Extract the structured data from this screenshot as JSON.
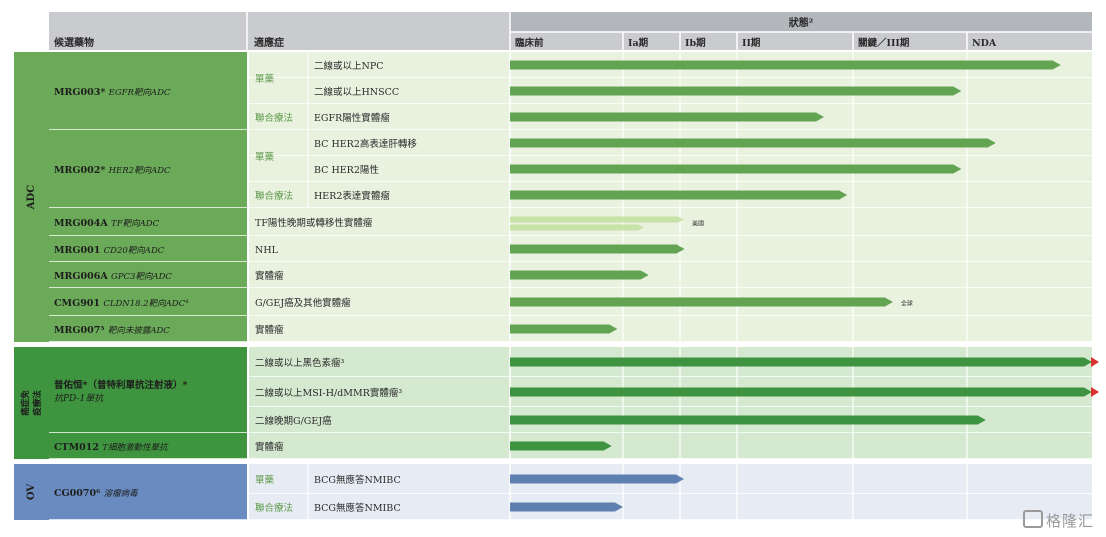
{
  "header": {
    "candidate_label": "候選藥物",
    "indication_label": "適應症",
    "status_label": "狀態²",
    "phases": [
      "臨床前",
      "Ia期",
      "Ib期",
      "II期",
      "關鍵／III期",
      "NDA"
    ]
  },
  "colors": {
    "adc_band": "#6aaa58",
    "adc_row": "#e9f1df",
    "adc_bar": "#62a451",
    "adc_light_bar": "#c7e3a8",
    "io_band": "#3f953f",
    "io_row": "#d5e9d0",
    "io_bar": "#3e9340",
    "ov_band": "#6a8bbf",
    "ov_row": "#e7ecf4",
    "ov_bar": "#5e80b1",
    "header_bg": "#bcbec3",
    "arrow_red": "#d9332f",
    "single_drug_text": "#5d9a4a"
  },
  "groups": [
    {
      "id": "adc",
      "label": "ADC",
      "candidates": [
        {
          "id": "mrg003",
          "name": "MRG003*",
          "target": "EGFR靶向ADC",
          "rows": [
            {
              "type": "單藥",
              "indication": "二線或以上NPC",
              "phase": 5.75
            },
            {
              "type": "",
              "indication": "二線或以上HNSCC",
              "phase": 4.95
            },
            {
              "type": "聯合療法",
              "indication": "EGFR陽性實體瘤",
              "phase": 3.75
            }
          ]
        },
        {
          "id": "mrg002",
          "name": "MRG002*",
          "target": "HER2靶向ADC",
          "rows": [
            {
              "type": "單藥",
              "indication": "BC HER2高表達肝轉移",
              "phase": 5.23
            },
            {
              "type": "",
              "indication": "BC HER2陽性",
              "phase": 4.95
            },
            {
              "type": "聯合療法",
              "indication": "HER2表達實體瘤",
              "phase": 3.95
            }
          ]
        },
        {
          "id": "mrg004a",
          "name": "MRG004A",
          "target": "TF靶向ADC",
          "rows": [
            {
              "type": "",
              "indication": "TF陽性晚期或轉移性實體瘤",
              "phase": 2.07,
              "light": true,
              "region": "美國"
            }
          ]
        },
        {
          "id": "mrg001",
          "name": "MRG001",
          "target": "CD20靶向ADC",
          "rows": [
            {
              "type": "",
              "indication": "NHL",
              "phase": 2.08
            }
          ]
        },
        {
          "id": "mrg006a",
          "name": "MRG006A",
          "target": "GPC3靶向ADC",
          "rows": [
            {
              "type": "",
              "indication": "實體瘤",
              "phase": 1.45
            }
          ]
        },
        {
          "id": "cmg901",
          "name": "CMG901",
          "target": "CLDN18.2靶向ADC⁴",
          "rows": [
            {
              "type": "",
              "indication": "G/GEJ癌及其他實體瘤",
              "phase": 4.35,
              "region": "全球"
            }
          ]
        },
        {
          "id": "mrg007",
          "name": "MRG007⁵",
          "target": "靶向未披露ADC",
          "rows": [
            {
              "type": "",
              "indication": "實體瘤",
              "phase": 0.95
            }
          ]
        }
      ]
    },
    {
      "id": "io",
      "label": "癌症免疫療法",
      "candidates": [
        {
          "id": "pucotenlimab",
          "name": "普佑恒*（普特利單抗注射液）*",
          "target": "抗PD-1單抗",
          "rows": [
            {
              "type": "",
              "indication": "二線或以上黑色素瘤³",
              "phase": 6,
              "red_arrow": true
            },
            {
              "type": "",
              "indication": "二線或以上MSI-H/dMMR實體瘤³",
              "phase": 6,
              "red_arrow": true
            },
            {
              "type": "",
              "indication": "二線晚期G/GEJ癌",
              "phase": 5.15
            }
          ]
        },
        {
          "id": "ctm012",
          "name": "CTM012",
          "target": "T細胞激動性單抗",
          "rows": [
            {
              "type": "",
              "indication": "實體瘤",
              "phase": 0.9
            }
          ]
        }
      ]
    },
    {
      "id": "ov",
      "label": "OV",
      "candidates": [
        {
          "id": "cg0070",
          "name": "CG0070⁶",
          "target": "溶瘤病毒",
          "rows": [
            {
              "type": "單藥",
              "indication": "BCG無應答NMIBC",
              "phase": 2.07
            },
            {
              "type": "聯合療法",
              "indication": "BCG無應答NMIBC",
              "phase": 1.0
            }
          ]
        }
      ]
    }
  ],
  "watermark": "格隆汇"
}
